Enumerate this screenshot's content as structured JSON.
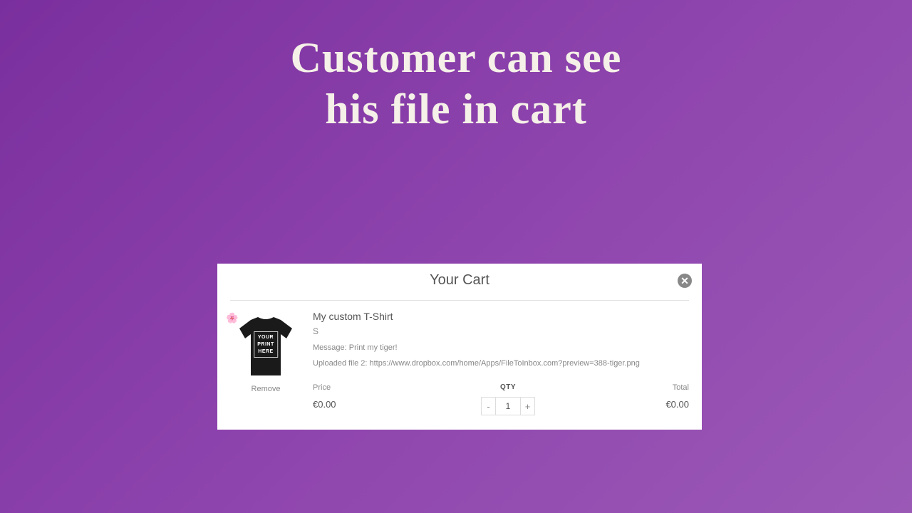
{
  "headline": {
    "line1": "Customer can see",
    "line2": "his file in cart"
  },
  "cart": {
    "title": "Your Cart",
    "item": {
      "name": "My custom T-Shirt",
      "variant": "S",
      "message": "Message: Print my tiger!",
      "uploaded_file": "Uploaded file 2: https://www.dropbox.com/home/Apps/FileToInbox.com?preview=388-tiger.png",
      "print_text": "YOUR\nPRINT\nHERE",
      "remove_label": "Remove"
    },
    "labels": {
      "price": "Price",
      "qty": "QTY",
      "total": "Total"
    },
    "values": {
      "price": "€0.00",
      "qty": "1",
      "total": "€0.00"
    }
  }
}
